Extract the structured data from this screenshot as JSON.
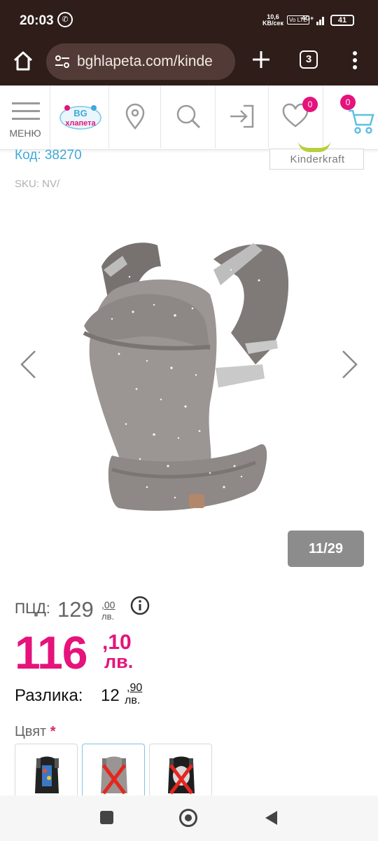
{
  "status_bar": {
    "time": "20:03",
    "net_speed_value": "10,6",
    "net_speed_unit": "KB/сек",
    "volte": "Vo LTE",
    "network": "4G+",
    "battery": "41"
  },
  "browser": {
    "url": "bghlapeta.com/kinde",
    "tab_count": "3"
  },
  "site_nav": {
    "menu_label": "МЕНЮ",
    "logo_text": "BG хлапета",
    "wishlist_count": "0",
    "cart_count": "0"
  },
  "product": {
    "code_label": "Код: 38270",
    "sku_label": "SKU: NV/",
    "brand": "Kinderkraft",
    "gallery_counter": "11/29",
    "rrp_label": "ПЦД:",
    "rrp_main": "129",
    "rrp_cents": ",00",
    "rrp_currency": "лв.",
    "price_main": "116",
    "price_cents": ",10",
    "price_currency": "лв.",
    "diff_label": "Разлика:",
    "diff_main": "12",
    "diff_cents": ",90",
    "diff_currency": "лв.",
    "color_label": "Цвят",
    "required_mark": "*"
  },
  "swatches": [
    {
      "name": "black-multicolor",
      "selected": false,
      "available": true
    },
    {
      "name": "grey-stars",
      "selected": true,
      "available": false
    },
    {
      "name": "black-white",
      "selected": false,
      "available": false
    }
  ],
  "colors": {
    "accent_pink": "#e5137b",
    "link_blue": "#3fa9d8",
    "browser_bar": "#2e1d19",
    "url_field": "#523b36",
    "counter_bg": "#8c8c8c"
  }
}
